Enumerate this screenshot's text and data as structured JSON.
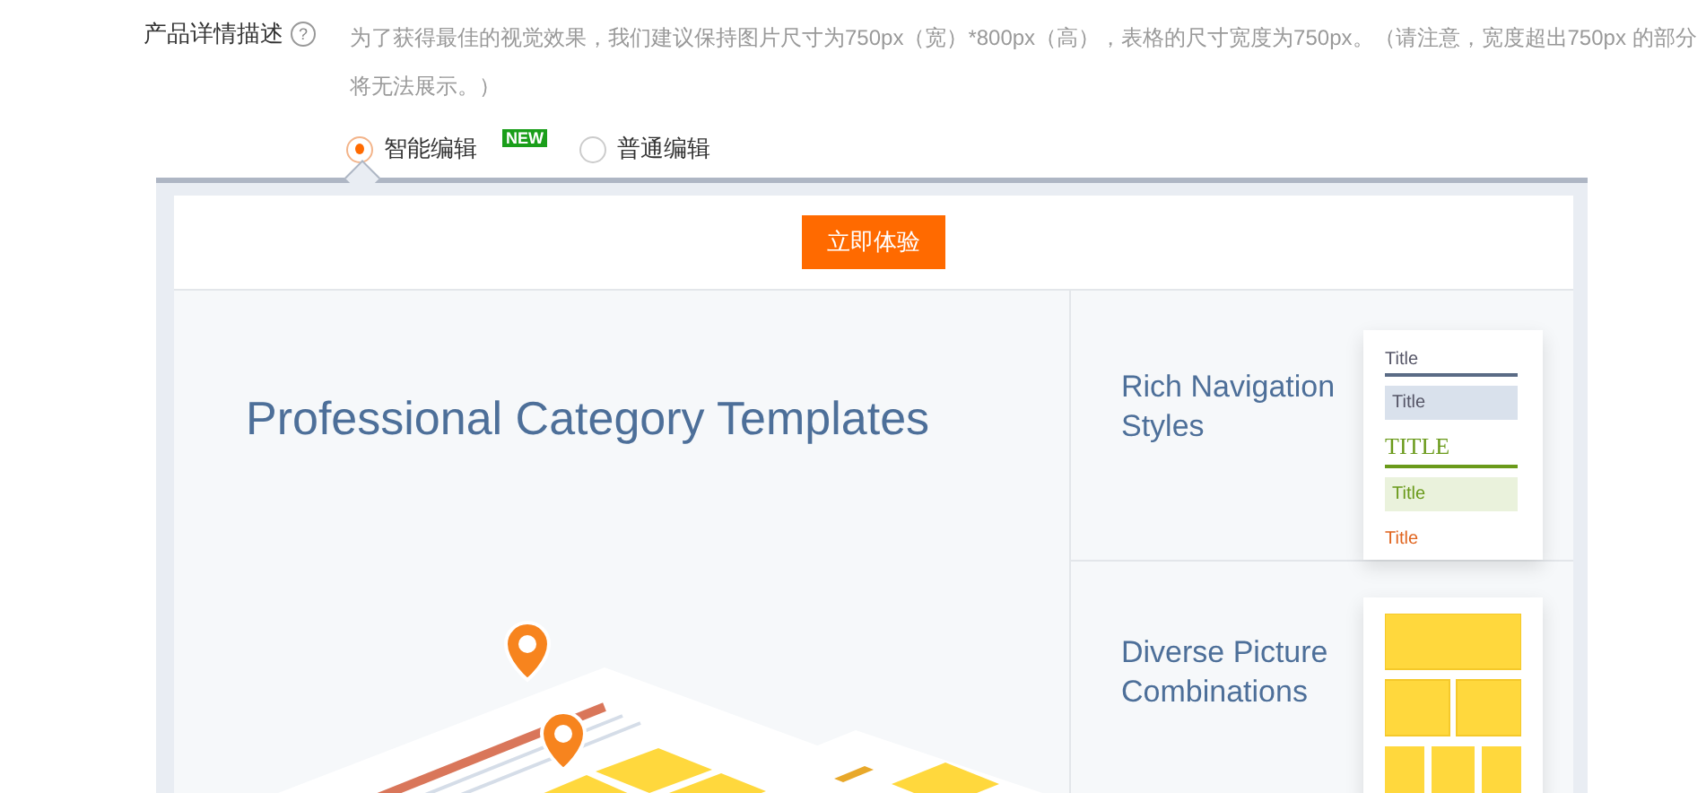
{
  "field": {
    "label": "产品详情描述",
    "help": "?",
    "description": "为了获得最佳的视觉效果，我们建议保持图片尺寸为750px（宽）*800px（高），表格的尺寸宽度为750px。（请注意，宽度超出750px 的部分将无法展示。）"
  },
  "editor_modes": [
    {
      "label": "智能编辑",
      "badge": "NEW",
      "selected": true
    },
    {
      "label": "普通编辑",
      "selected": false
    }
  ],
  "try_button": "立即体验",
  "hero": {
    "title": "Professional Category Templates"
  },
  "features": [
    {
      "title": "Rich Navigation Styles",
      "kind": "navigation",
      "samples": [
        {
          "text": "Title",
          "kind": "underline"
        },
        {
          "text": "Title",
          "kind": "filled"
        },
        {
          "text": "TITLE",
          "kind": "serif"
        },
        {
          "text": "Title",
          "kind": "green"
        },
        {
          "text": "Title",
          "kind": "orange"
        }
      ]
    },
    {
      "title": "Diverse Picture Combinations",
      "kind": "pictures"
    }
  ]
}
